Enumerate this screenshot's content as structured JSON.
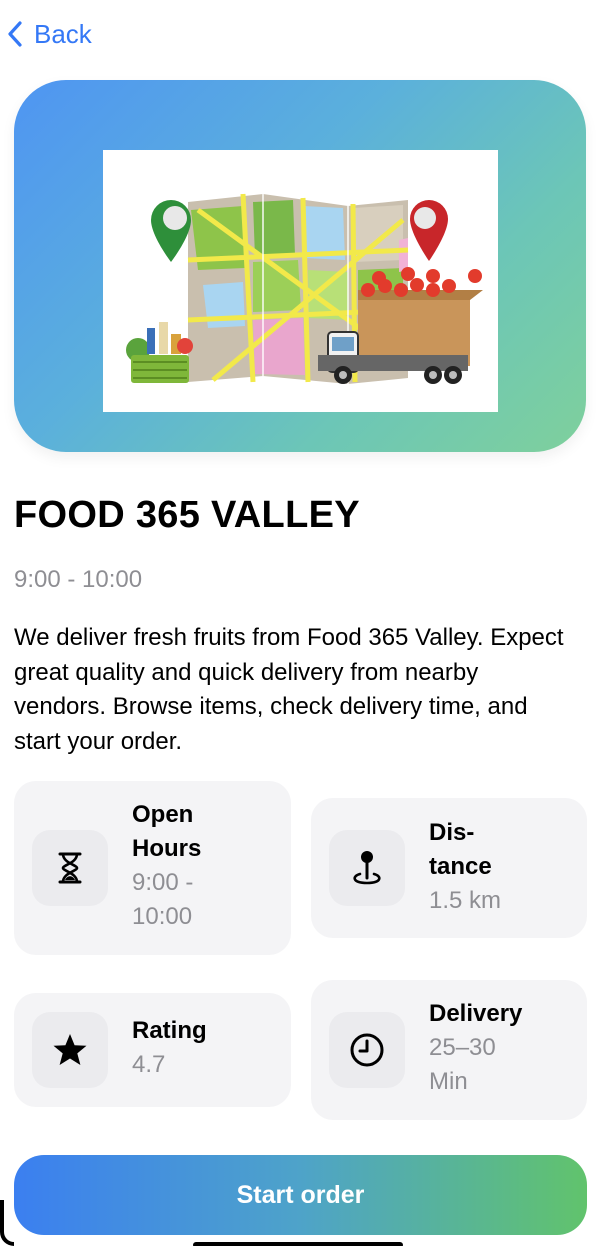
{
  "nav": {
    "back_label": "Back"
  },
  "store": {
    "name": "FOOD 365 VALLEY",
    "hours": "9:00 - 10:00",
    "description": "We deliver fresh fruits from Food 365 Valley. Expect great quality and quick delivery from nearby vendors. Browse items, check delivery time, and start your order."
  },
  "info": {
    "open_hours": {
      "label_1": "Open",
      "label_2": "Hours",
      "value_1": "9:00 -",
      "value_2": "10:00",
      "icon": "hourglass-icon"
    },
    "distance": {
      "label_1": "Dis-",
      "label_2": "tance",
      "value": "1.5 km",
      "icon": "location-pin-icon"
    },
    "rating": {
      "label": "Rating",
      "value": "4.7",
      "icon": "star-icon"
    },
    "delivery": {
      "label": "Delivery",
      "value_1": "25–30",
      "value_2": "Min",
      "icon": "clock-icon"
    }
  },
  "cta": {
    "label": "Start order"
  },
  "colors": {
    "accent": "#3478f6",
    "gradient_start": "#3b7ff0",
    "gradient_end": "#61c36c"
  }
}
